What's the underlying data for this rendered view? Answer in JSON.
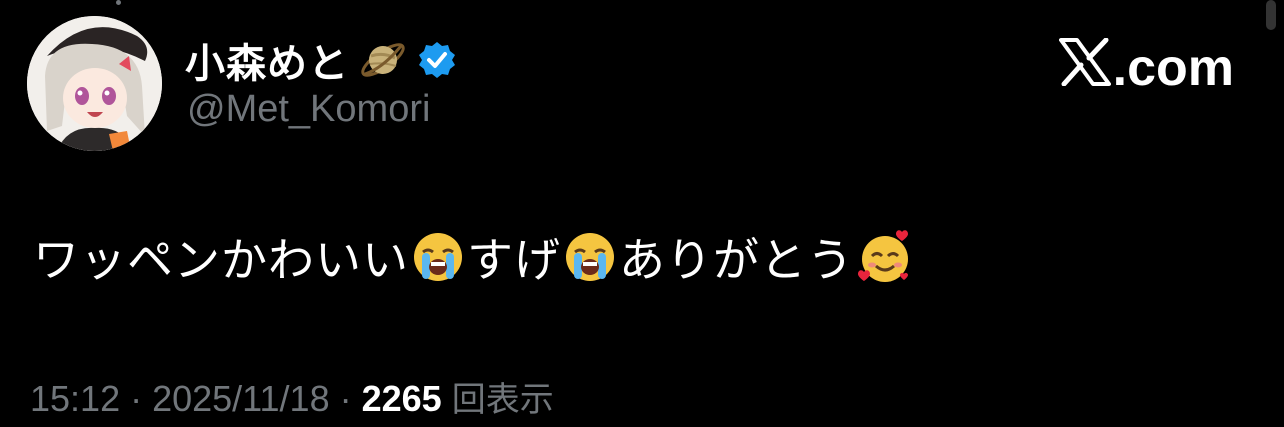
{
  "author": {
    "display_name": "小森めと",
    "handle": "@Met_Komori",
    "badge_icon": "planet-icon",
    "verified_icon": "verified-icon",
    "verified_color": "#1d9bf0"
  },
  "brand": {
    "label": ".com",
    "icon": "x-logo-icon"
  },
  "tweet": {
    "text_part1": "ワッペンかわいい",
    "text_part2": "すげ",
    "text_part3": "ありがとう",
    "emojis": [
      "crying-face-icon",
      "crying-face-icon",
      "smiling-face-with-hearts-icon"
    ]
  },
  "meta": {
    "time": "15:12",
    "separator": "·",
    "date": "2025/11/18",
    "views_count": "2265",
    "views_label": "回表示"
  },
  "colors": {
    "background": "#000000",
    "text_primary": "#ffffff",
    "text_secondary": "#71767b"
  }
}
